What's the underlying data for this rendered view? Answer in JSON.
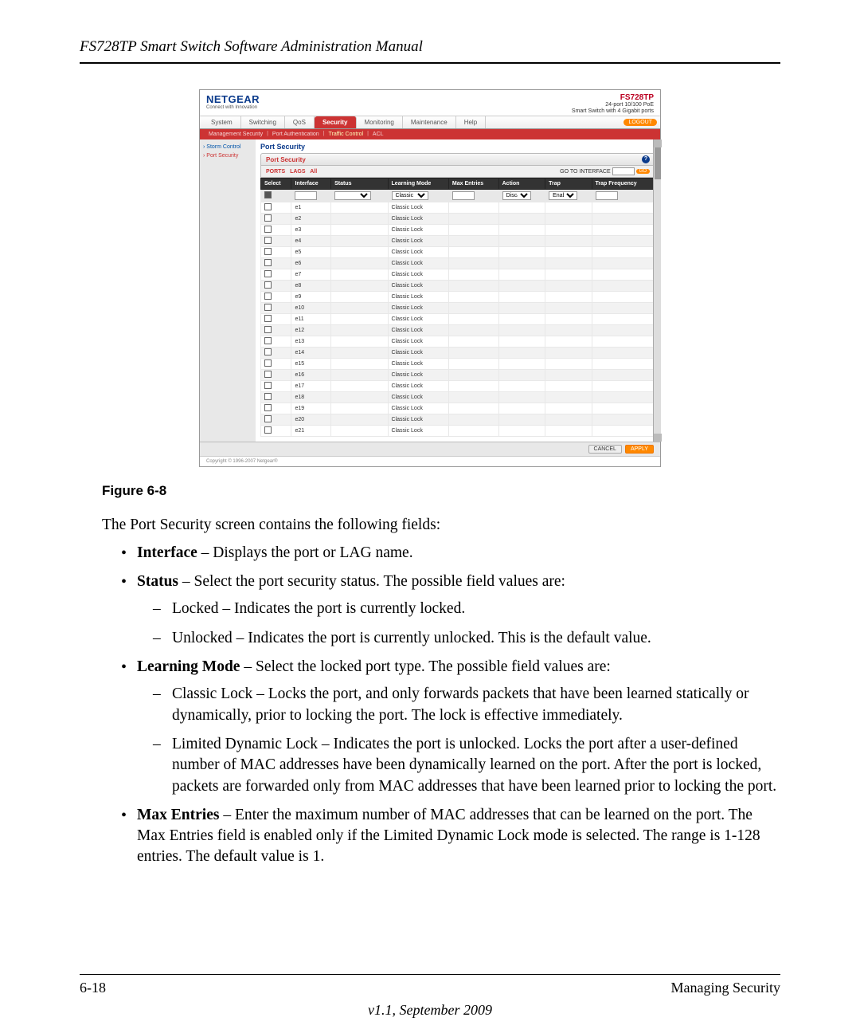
{
  "doc": {
    "header": "FS728TP Smart Switch Software Administration Manual",
    "figure_caption": "Figure 6-8",
    "intro": "The Port Security screen contains the following fields:",
    "footer_left": "6-18",
    "footer_right": "Managing Security",
    "version": "v1.1, September 2009"
  },
  "fields": {
    "interface_label": "Interface",
    "interface_text": " – Displays the port or LAG name.",
    "status_label": "Status",
    "status_text": " – Select the port security status. The possible field values are:",
    "status_locked": "Locked – Indicates the port is currently locked.",
    "status_unlocked": "Unlocked – Indicates the port is currently unlocked. This is the default value.",
    "learning_label": "Learning Mode",
    "learning_text": " – Select the locked port type. The possible field values are:",
    "learning_classic": "Classic Lock – Locks the port, and only forwards packets that have been learned statically or dynamically, prior to locking the port. The lock is effective immediately.",
    "learning_limited": "Limited Dynamic Lock – Indicates the port is unlocked. Locks the port after a user-defined number of MAC addresses have been dynamically learned on the port. After the port is locked, packets are forwarded only from MAC addresses that have been learned prior to locking the port.",
    "max_label": "Max Entries",
    "max_text": " – Enter the maximum number of MAC addresses that can be learned on the port. The Max Entries field is enabled only if the Limited Dynamic Lock mode is selected. The range is 1-128 entries. The default value is 1."
  },
  "ss": {
    "brand": "NETGEAR",
    "tagline": "Connect with Innovation",
    "model": "FS728TP",
    "model_sub1": "24-port 10/100 PoE",
    "model_sub2": "Smart Switch with 4 Gigabit ports",
    "tabs": [
      "System",
      "Switching",
      "QoS",
      "Security",
      "Monitoring",
      "Maintenance",
      "Help"
    ],
    "logout": "LOGOUT",
    "subtabs": [
      "Management Security",
      "Port Authentication",
      "Traffic Control",
      "ACL"
    ],
    "side": [
      "Storm Control",
      "Port Security"
    ],
    "panel_title": "Port Security",
    "sub_title": "Port Security",
    "filters": [
      "PORTS",
      "LAGS",
      "All"
    ],
    "goto_label": "GO TO INTERFACE",
    "go": "GO",
    "cols": [
      "Select",
      "Interface",
      "Status",
      "Learning Mode",
      "Max Entries",
      "Action",
      "Trap",
      "Trap Frequency"
    ],
    "ctrl_learning": "Classic Lock",
    "ctrl_action": "Discard",
    "ctrl_trap": "Enable",
    "rows": [
      {
        "if": "e1",
        "lm": "Classic Lock"
      },
      {
        "if": "e2",
        "lm": "Classic Lock"
      },
      {
        "if": "e3",
        "lm": "Classic Lock"
      },
      {
        "if": "e4",
        "lm": "Classic Lock"
      },
      {
        "if": "e5",
        "lm": "Classic Lock"
      },
      {
        "if": "e6",
        "lm": "Classic Lock"
      },
      {
        "if": "e7",
        "lm": "Classic Lock"
      },
      {
        "if": "e8",
        "lm": "Classic Lock"
      },
      {
        "if": "e9",
        "lm": "Classic Lock"
      },
      {
        "if": "e10",
        "lm": "Classic Lock"
      },
      {
        "if": "e11",
        "lm": "Classic Lock"
      },
      {
        "if": "e12",
        "lm": "Classic Lock"
      },
      {
        "if": "e13",
        "lm": "Classic Lock"
      },
      {
        "if": "e14",
        "lm": "Classic Lock"
      },
      {
        "if": "e15",
        "lm": "Classic Lock"
      },
      {
        "if": "e16",
        "lm": "Classic Lock"
      },
      {
        "if": "e17",
        "lm": "Classic Lock"
      },
      {
        "if": "e18",
        "lm": "Classic Lock"
      },
      {
        "if": "e19",
        "lm": "Classic Lock"
      },
      {
        "if": "e20",
        "lm": "Classic Lock"
      },
      {
        "if": "e21",
        "lm": "Classic Lock"
      }
    ],
    "cancel": "CANCEL",
    "apply": "APPLY",
    "copyright": "Copyright © 1996-2007 Netgear®"
  }
}
